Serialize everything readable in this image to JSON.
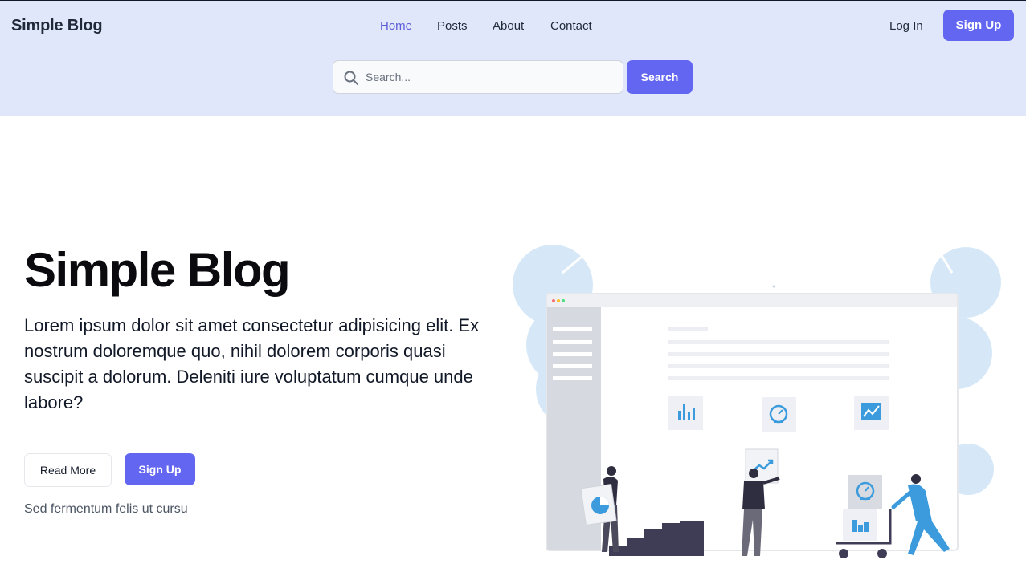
{
  "header": {
    "brand": "Simple Blog",
    "nav": [
      {
        "label": "Home",
        "active": true
      },
      {
        "label": "Posts",
        "active": false
      },
      {
        "label": "About",
        "active": false
      },
      {
        "label": "Contact",
        "active": false
      }
    ],
    "login_label": "Log In",
    "signup_label": "Sign Up"
  },
  "search": {
    "placeholder": "Search...",
    "value": "",
    "button_label": "Search"
  },
  "hero": {
    "title": "Simple Blog",
    "text": "Lorem ipsum dolor sit amet consectetur adipisicing elit. Ex nostrum doloremque quo, nihil dolorem corporis quasi suscipit a dolorum. Deleniti iure voluptatum cumque unde labore?",
    "read_more_label": "Read More",
    "signup_label": "Sign Up",
    "note": "Sed fermentum felis ut cursu"
  },
  "colors": {
    "header_bg": "#e0e7fb",
    "accent": "#6366f1",
    "active_nav": "#5b5bd6",
    "illustration_blue": "#3b9bdc"
  },
  "icons": [
    "search-icon",
    "bar-chart-icon",
    "speedometer-icon",
    "trend-chart-icon",
    "pie-chart-icon"
  ]
}
